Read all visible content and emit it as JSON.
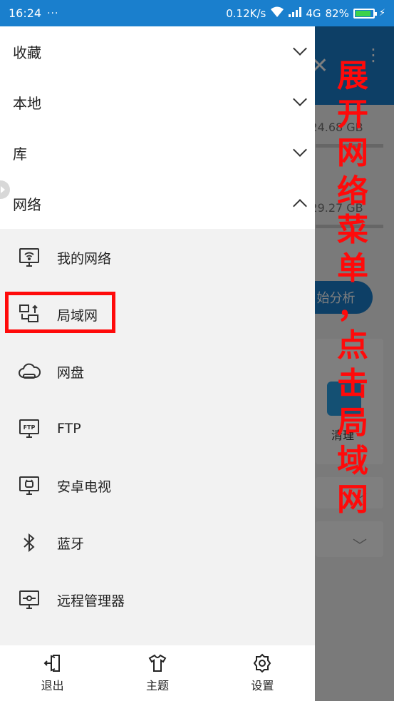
{
  "status_bar": {
    "time": "16:24",
    "dots": "···",
    "speed": "0.12K/s",
    "network": "4G",
    "battery": "82%"
  },
  "background_app": {
    "storage_1": "/24.68 GB",
    "storage_2": "/29.27 GB",
    "analyze_button": "始分析",
    "clean_label": "清理"
  },
  "drawer": {
    "sections": [
      {
        "label": "收藏"
      },
      {
        "label": "本地"
      },
      {
        "label": "库"
      },
      {
        "label": "网络"
      }
    ],
    "network_items": [
      {
        "label": "我的网络",
        "icon": "wifi-monitor-icon"
      },
      {
        "label": "局域网",
        "icon": "lan-icon"
      },
      {
        "label": "网盘",
        "icon": "cloud-disk-icon"
      },
      {
        "label": "FTP",
        "icon": "ftp-icon"
      },
      {
        "label": "安卓电视",
        "icon": "android-tv-icon"
      },
      {
        "label": "蓝牙",
        "icon": "bluetooth-icon"
      },
      {
        "label": "远程管理器",
        "icon": "remote-manager-icon"
      }
    ],
    "bottom": {
      "exit_label": "退出",
      "theme_label": "主题",
      "settings_label": "设置"
    }
  },
  "instruction": [
    "展",
    "开",
    "网",
    "络",
    "菜",
    "单",
    "，",
    "点",
    "击",
    "局",
    "域",
    "网"
  ],
  "colors": {
    "accent": "#1a7fcd",
    "highlight": "#ff0a0a"
  }
}
